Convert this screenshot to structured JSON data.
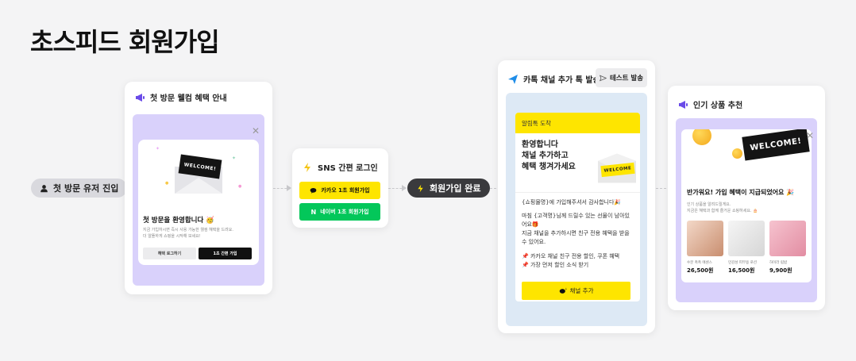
{
  "title": "초스피드 회원가입",
  "flow": {
    "start_label": "첫 방문 유저 진입",
    "complete_label": "회원가입 완료"
  },
  "welcome_card": {
    "header": "첫 방문 웰컴 혜택 안내",
    "ticket_text": "WELCOME!",
    "modal_title": "첫 방문을 환영합니다 🥳",
    "modal_desc_1": "지금 가입하시면 즉시 사용 가능한 웰컴 혜택을 드려요.",
    "modal_desc_2": "더 알뜰하게 쇼핑을 시작해 보세요!",
    "btn_secondary": "혜택 로그하기",
    "btn_primary": "1초 간편 가입"
  },
  "sns_card": {
    "header": "SNS 간편 로그인",
    "kakao_btn": "카카오 1초 회원가입",
    "naver_btn": "네이버 1초 회원가입",
    "kakao_color": "#fee500",
    "naver_color": "#03c75a"
  },
  "kakao_card": {
    "header": "카톡 채널 추가 톡 발송",
    "test_btn": "테스트 발송",
    "msg_top": "알림톡 도착",
    "headline_1": "환영합니다",
    "headline_2": "채널 추가하고",
    "headline_3": "혜택 챙겨가세요",
    "ticket_text": "WELCOME",
    "body_1": "{쇼핑몰명}에 가입해주셔서 감사합니다🎉",
    "body_2": "마침 {고객명}님께 드릴수 있는 선물이 남아있",
    "body_3": "어요🎁",
    "body_4": "지금 채널을 추가하시면 친구 전용 혜택을 받을",
    "body_5": "수 있어요.",
    "body_6": "📌 카카오 채널 친구 전용 할인, 쿠폰 혜택",
    "body_7": "📌 가장 먼저 할인 소식 받기",
    "btn": "채널 추가"
  },
  "popular_card": {
    "header": "인기 상품 추천",
    "ticket_text": "WELCOME!",
    "modal_title": "반가워요! 가입 혜택이 지급되었어요 🎉",
    "modal_desc_1": "인기 상품을 알려드릴게요.",
    "modal_desc_2": "지금은 혜택과 함께 즐거운 쇼핑하세요. 🎂",
    "products": [
      {
        "name": "수분 촉촉 에센스",
        "price": "26,500원"
      },
      {
        "name": "민감성 피부용 로션",
        "price": "16,500원"
      },
      {
        "name": "하이라 립밤",
        "price": "9,900원"
      }
    ]
  },
  "colors": {
    "purple_bg": "#d9d1fb",
    "blue_bg": "#dde9f5",
    "kakao_yellow": "#fee500",
    "naver_green": "#03c75a",
    "accent_purple": "#6a4be8"
  }
}
